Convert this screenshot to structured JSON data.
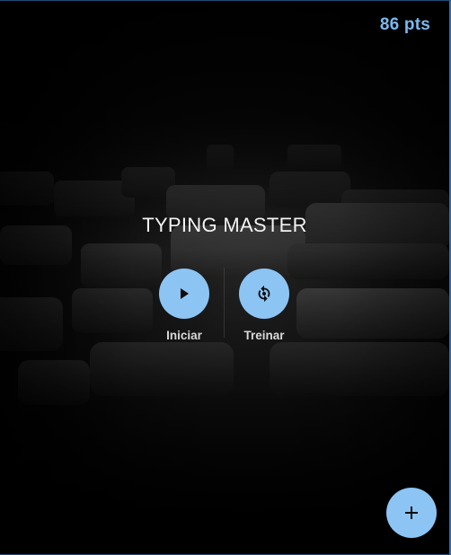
{
  "header": {
    "points_label": "86 pts"
  },
  "main": {
    "title": "TYPING MASTER",
    "actions": [
      {
        "label": "Iniciar",
        "icon": "play-icon"
      },
      {
        "label": "Treinar",
        "icon": "replay-icon"
      }
    ]
  },
  "fab": {
    "icon": "plus-icon"
  },
  "colors": {
    "accent": "#8cc4f4",
    "points_text": "#7ab8ee",
    "background": "#000000"
  }
}
